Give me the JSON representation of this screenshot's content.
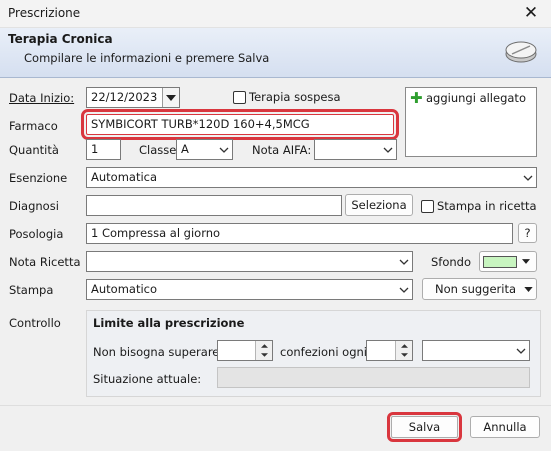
{
  "window": {
    "title": "Prescrizione",
    "close_icon": "close-icon"
  },
  "header": {
    "title": "Terapia Cronica",
    "subtitle": "Compilare le informazioni e premere Salva",
    "icon": "pill-tablet-icon"
  },
  "form": {
    "data_inizio": {
      "label": "Data Inizio:",
      "value": "22/12/2023"
    },
    "terapia_sospesa": {
      "label": "Terapia sospesa",
      "checked": false
    },
    "allegato": {
      "label": "aggiungi allegato",
      "icon": "plus-icon",
      "icon_color": "#2e9e2e"
    },
    "farmaco": {
      "label": "Farmaco",
      "value": "SYMBICORT TURB*120D 160+4,5MCG"
    },
    "quantita": {
      "label": "Quantità",
      "value": "1"
    },
    "classe": {
      "label": "Classe",
      "value": "A"
    },
    "nota_aifa": {
      "label": "Nota AIFA:",
      "value": ""
    },
    "esenzione": {
      "label": "Esenzione",
      "value": "Automatica"
    },
    "diagnosi": {
      "label": "Diagnosi",
      "value": "",
      "button": "Seleziona"
    },
    "stampa_in_ricetta": {
      "label": "Stampa in ricetta",
      "checked": false
    },
    "posologia": {
      "label": "Posologia",
      "value": "1 Compressa al giorno",
      "help": "?"
    },
    "nota_ricetta": {
      "label": "Nota Ricetta",
      "value": ""
    },
    "sfondo": {
      "label": "Sfondo",
      "color": "#c8f5c0"
    },
    "stampa": {
      "label": "Stampa",
      "value": "Automatico",
      "suggestion": "Non suggerita"
    },
    "controllo": {
      "label": "Controllo",
      "group_title": "Limite alla prescrizione",
      "non_superare_label": "Non bisogna superare",
      "confezioni_label": "confezioni ogni",
      "qty_value": "",
      "period_value": "",
      "period_unit": "",
      "situazione_label": "Situazione attuale:",
      "situazione_value": ""
    }
  },
  "buttons": {
    "save": "Salva",
    "cancel": "Annulla"
  },
  "colors": {
    "highlight": "#d9363e"
  }
}
